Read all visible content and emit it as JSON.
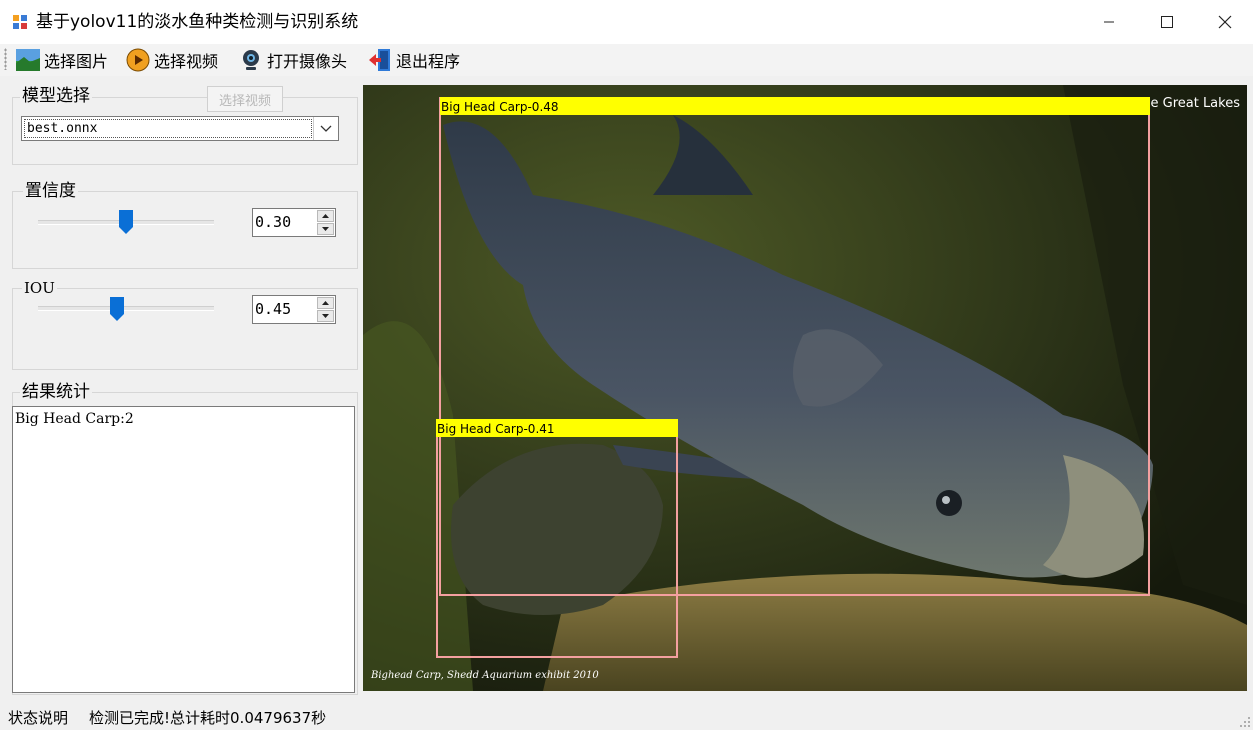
{
  "window": {
    "title": "基于yolov11的淡水鱼种类检测与识别系统",
    "controls": [
      "minimize",
      "maximize",
      "close"
    ]
  },
  "toolbar": {
    "items": [
      {
        "label": "选择图片",
        "icon": "image-icon"
      },
      {
        "label": "选择视频",
        "icon": "play-icon"
      },
      {
        "label": "打开摄像头",
        "icon": "webcam-icon"
      },
      {
        "label": "退出程序",
        "icon": "exit-door-icon"
      }
    ]
  },
  "tooltip": "选择视频",
  "model": {
    "group_title": "模型选择",
    "selected": "best.onnx"
  },
  "confidence": {
    "group_title": "置信度",
    "value": "0.30",
    "level": 0.5
  },
  "iou": {
    "group_title": "IOU",
    "value": "0.45",
    "level": 0.45
  },
  "results": {
    "group_title": "结果统计",
    "text": "Big Head Carp:2"
  },
  "image": {
    "corner_text": "e Great Lakes",
    "caption": "Bighead Carp, Shedd Aquarium exhibit 2010",
    "detections": [
      {
        "label": "Big Head Carp-0.48"
      },
      {
        "label": "Big Head Carp-0.41"
      }
    ],
    "colors": {
      "label_bg": "#ffff00",
      "box": "#f4a0a0"
    }
  },
  "status": {
    "label": "状态说明",
    "message": "检测已完成!总计耗时0.0479637秒"
  }
}
